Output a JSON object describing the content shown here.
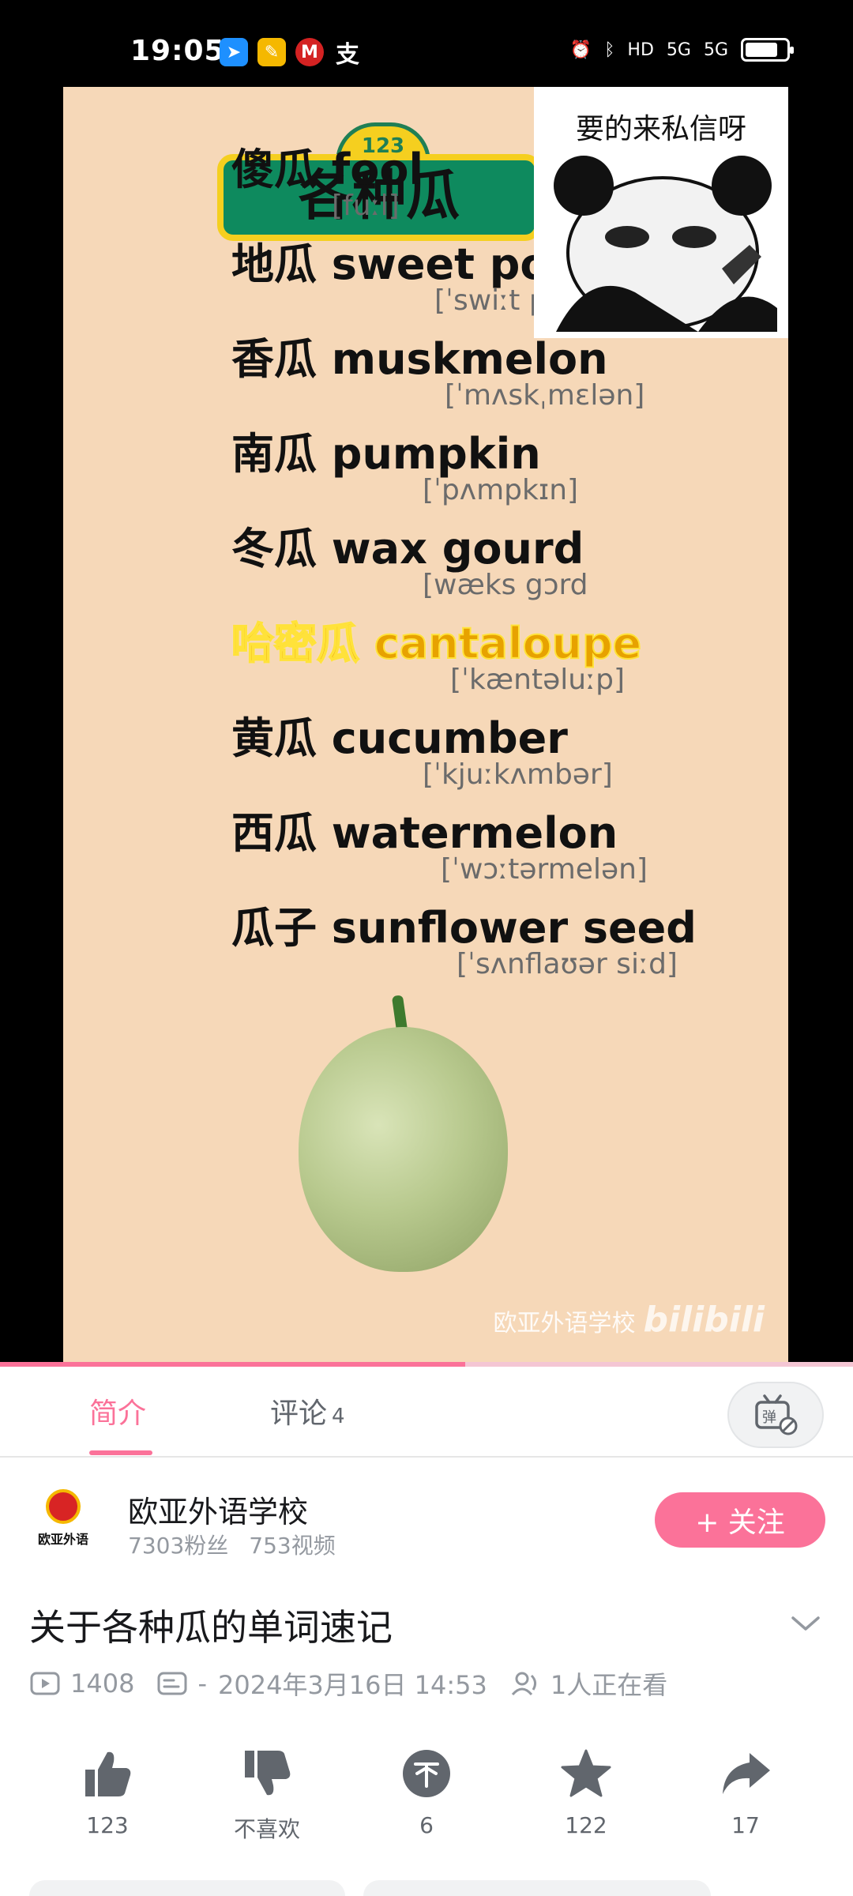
{
  "status_bar": {
    "time": "19:05",
    "apps": [
      "feishu-icon",
      "notes-icon",
      "bank-icon",
      "alipay-icon"
    ],
    "right": [
      "alarm-icon",
      "bluetooth-icon",
      "HD",
      "5G",
      "5G",
      "battery-icon"
    ],
    "battery_level": 0.8
  },
  "video": {
    "sign_number": "123",
    "sign_title": "各种瓜",
    "meme_text": "要的来私信呀",
    "words": [
      {
        "text": "傻瓜 fool",
        "phonetic": "[fuːl]",
        "highlight": false
      },
      {
        "text": "地瓜 sweet potato",
        "phonetic": "[ˈswiːt pəteɪtoʊ]",
        "highlight": false
      },
      {
        "text": "香瓜 muskmelon",
        "phonetic": "[ˈmʌskˌmɛlən]",
        "highlight": false
      },
      {
        "text": "南瓜 pumpkin",
        "phonetic": "[ˈpʌmpkɪn]",
        "highlight": false
      },
      {
        "text": "冬瓜 wax gourd",
        "phonetic": "[wæks gɔrd",
        "highlight": false
      },
      {
        "text": "哈密瓜 cantaloupe",
        "phonetic": "[ˈkæntəluːp]",
        "highlight": true
      },
      {
        "text": "黄瓜 cucumber",
        "phonetic": "[ˈkjuːkʌmbər]",
        "highlight": false
      },
      {
        "text": "西瓜 watermelon",
        "phonetic": "[ˈwɔːtərmelən]",
        "highlight": false
      },
      {
        "text": "瓜子 sunflower seed",
        "phonetic": "[ˈsʌnflaʊər siːd]",
        "highlight": false
      }
    ],
    "watermark": "欧亚外语学校",
    "watermark_logo": "bilibili",
    "progress": 0.545
  },
  "tabs": {
    "intro_label": "简介",
    "comments_label": "评论",
    "comments_count": "4",
    "active": "intro"
  },
  "uploader": {
    "avatar_text": "欧亚外语",
    "name": "欧亚外语学校",
    "fans": "7303粉丝",
    "videos": "753视频",
    "follow_label": "+ 关注"
  },
  "video_info": {
    "title": "关于各种瓜的单词速记",
    "views": "1408",
    "danmaku": "-",
    "date": "2024年3月16日 14:53",
    "watching": "1人正在看"
  },
  "actions": {
    "like": "123",
    "dislike": "不喜欢",
    "coin": "6",
    "favorite": "122",
    "share": "17"
  },
  "colors": {
    "accent": "#fb7299",
    "video_bg": "#f6d8b8",
    "sign_green": "#0e8a5e",
    "sign_yellow": "#f5cf1f",
    "icon_gray": "#61666d"
  }
}
